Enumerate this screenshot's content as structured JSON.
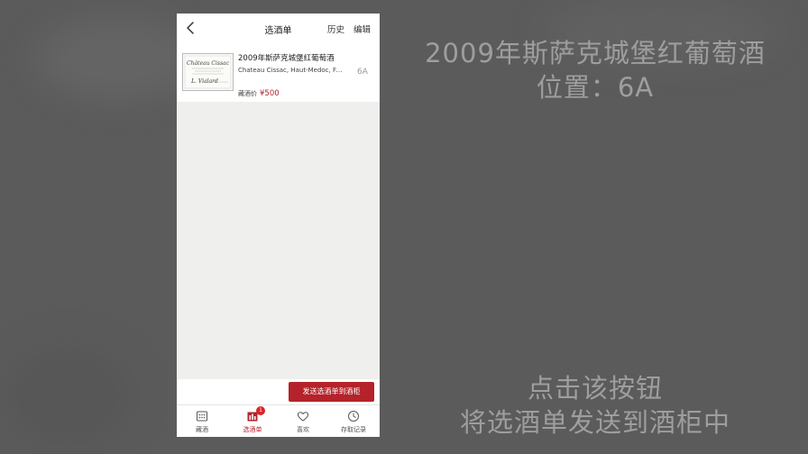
{
  "app": {
    "nav": {
      "title": "选酒单",
      "history": "历史",
      "edit": "编辑"
    },
    "list": [
      {
        "name": "2009年斯萨克城堡红葡萄酒",
        "subtitle": "Chateau Cissac, Haut-Medoc, Fra...",
        "price_label": "藏酒价",
        "price": "¥500",
        "position": "6A",
        "label_art": {
          "line1": "Château Cissac",
          "line2": "L. Vialard"
        }
      }
    ],
    "send_button": "发送选酒单到酒柜",
    "tabs": [
      {
        "label": "藏酒",
        "icon": "grid-icon"
      },
      {
        "label": "选酒单",
        "icon": "wine-rack-icon",
        "badge": "1",
        "active": true
      },
      {
        "label": "喜欢",
        "icon": "heart-icon"
      },
      {
        "label": "存取记录",
        "icon": "clock-icon"
      }
    ]
  },
  "overlay": {
    "title_line1": "2009年斯萨克城堡红葡萄酒",
    "title_line2": "位置：6A",
    "hint_line1": "点击该按钮",
    "hint_line2": "将选酒单发送到酒柜中"
  },
  "colors": {
    "accent": "#b5232a",
    "badge": "#d8232a",
    "content_bg": "#eff0ee",
    "outer_bg": "#5b5b5b"
  }
}
